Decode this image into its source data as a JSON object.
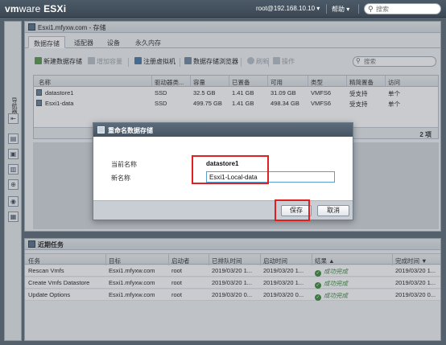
{
  "topbar": {
    "brand_a": "vm",
    "brand_b": "ware",
    "product": " ESXi",
    "user": "root@192.168.10.10 ▾",
    "help": "帮助 ▾",
    "search_placeholder": "搜索"
  },
  "nav": {
    "label": "导航器"
  },
  "main": {
    "title": "Esxi1.mfyxw.com - 存储",
    "tabs": [
      "数据存储",
      "适配器",
      "设备",
      "永久内存"
    ],
    "toolbar": {
      "new_ds": "新建数据存储",
      "add_cap": "增加容量",
      "register_vm": "注册虚拟机",
      "ds_browser": "数据存储浏览器",
      "refresh": "刷新",
      "actions": "操作",
      "search_placeholder": "搜索"
    },
    "table": {
      "headers": [
        "名称",
        "驱动器类...",
        "容量",
        "已置备",
        "可用",
        "类型",
        "精简置备",
        "访问"
      ],
      "rows": [
        [
          "datastore1",
          "SSD",
          "32.5 GB",
          "1.41 GB",
          "31.09 GB",
          "VMFS6",
          "受支持",
          "单个"
        ],
        [
          "Esxi1-data",
          "SSD",
          "499.75 GB",
          "1.41 GB",
          "498.34 GB",
          "VMFS6",
          "受支持",
          "单个"
        ]
      ],
      "count": "2 项"
    }
  },
  "tasks": {
    "title": "近期任务",
    "headers": [
      "任务",
      "目标",
      "启动者",
      "已排队时间",
      "启动时间",
      "结果 ▲",
      "完成时间 ▼"
    ],
    "rows": [
      [
        "Rescan Vmfs",
        "Esxi1.mfyxw.com",
        "root",
        "2019/03/20 1...",
        "2019/03/20 1...",
        "成功完成",
        "2019/03/20 1..."
      ],
      [
        "Create Vmfs Datastore",
        "Esxi1.mfyxw.com",
        "root",
        "2019/03/20 1...",
        "2019/03/20 1...",
        "成功完成",
        "2019/03/20 1..."
      ],
      [
        "Update Options",
        "Esxi1.mfyxw.com",
        "root",
        "2019/03/20 0...",
        "2019/03/20 0...",
        "成功完成",
        "2019/03/20 0..."
      ]
    ]
  },
  "dialog": {
    "title": "重命名数据存储",
    "current_label": "当前名称",
    "current_value": "datastore1",
    "new_label": "新名称",
    "new_value": "Esxi1-Local-data",
    "save": "保存",
    "cancel": "取消"
  },
  "colors": {
    "highlight": "#e02020",
    "header_dark": "#465462",
    "success": "#3d8b3d"
  }
}
